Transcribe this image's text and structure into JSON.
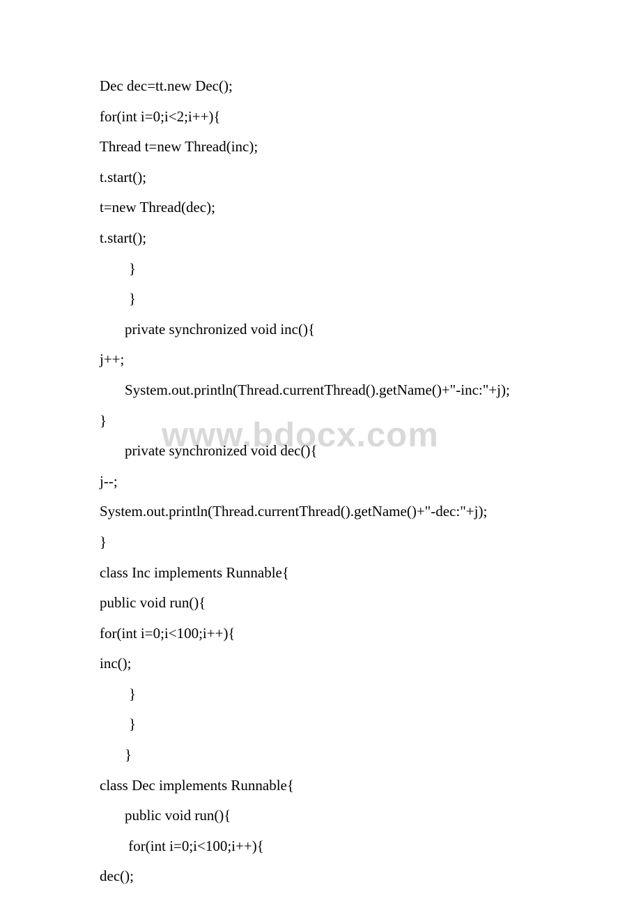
{
  "watermark": "www.bdocx.com",
  "code": {
    "l1": "Dec dec=tt.new Dec();",
    "l2": "for(int i=0;i<2;i++){",
    "l3": "Thread t=new Thread(inc);",
    "l4": "t.start();",
    "l5": "t=new Thread(dec);",
    "l6": "t.start();",
    "l7": "}",
    "l8": "}",
    "l9": "private synchronized void inc(){",
    "l10": "j++;",
    "l11": "System.out.println(Thread.currentThread().getName()+\"-inc:\"+j);",
    "l12": "}",
    "l13": "private synchronized void dec(){",
    "l14": "j--;",
    "l15": "System.out.println(Thread.currentThread().getName()+\"-dec:\"+j);",
    "l16": "}",
    "l17": "class Inc implements Runnable{",
    "l18": "public void run(){",
    "l19": "for(int i=0;i<100;i++){",
    "l20": "inc();",
    "l21": "}",
    "l22": "}",
    "l23": "}",
    "l24": "class Dec implements Runnable{",
    "l25": "public void run(){",
    "l26": " for(int i=0;i<100;i++){",
    "l27": "dec();"
  }
}
